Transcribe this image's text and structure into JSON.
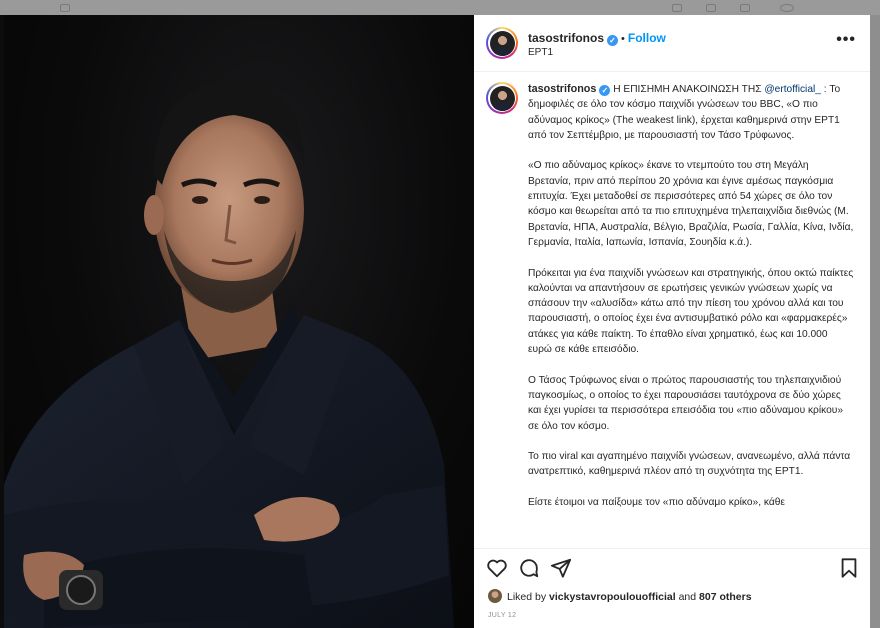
{
  "post": {
    "username": "tasostrifonos",
    "location": "ΕΡΤ1",
    "follow_label": "Follow",
    "separator": "•"
  },
  "caption": {
    "username": "tasostrifonos",
    "intro_before_mention": " Η ΕΠΙΣΗΜΗ ΑΝΑΚΟΙΝΩΣΗ ΤΗΣ ",
    "mention": "@ertofficial_",
    "intro_after_mention": " : Το δημοφιλές σε όλο τον κόσμο παιχνίδι γνώσεων του BBC, «Ο πιο αδύναμος κρίκος» (The weakest link), έρχεται καθημερινά στην ΕΡΤ1 από τον Σεπτέμβριο, με παρουσιαστή τον Τάσο Τρύφωνος.",
    "paragraphs": [
      "«Ο πιο αδύναμος κρίκος» έκανε το ντεμπούτο του στη Μεγάλη Βρετανία, πριν από περίπου 20 χρόνια και έγινε αμέσως παγκόσμια επιτυχία. Έχει μεταδοθεί σε περισσότερες από 54 χώρες σε όλο τον κόσμο και θεωρείται από τα πιο επιτυχημένα τηλεπαιχνίδια διεθνώς (Μ. Βρετανία, ΗΠΑ, Αυστραλία, Βέλγιο, Βραζιλία, Ρωσία, Γαλλία, Κίνα, Ινδία, Γερμανία, Ιταλία, Ιαπωνία, Ισπανία, Σουηδία κ.ά.).",
      "Πρόκειται για ένα παιχνίδι γνώσεων και στρατηγικής, όπου οκτώ παίκτες καλούνται να απαντήσουν σε ερωτήσεις γενικών γνώσεων χωρίς να σπάσουν την «αλυσίδα» κάτω από την πίεση του χρόνου αλλά και του παρουσιαστή, ο οποίος έχει ένα αντισυμβατικό ρόλο και «φαρμακερές» ατάκες για κάθε παίκτη. Το έπαθλο είναι χρηματικό, έως και 10.000 ευρώ σε κάθε επεισόδιο.",
      "Ο Τάσος Τρύφωνος είναι ο πρώτος παρουσιαστής του τηλεπαιχνιδιού παγκοσμίως, ο οποίος το έχει παρουσιάσει ταυτόχρονα σε δύο χώρες και έχει γυρίσει τα περισσότερα επεισόδια του «πιο αδύναμου κρίκου» σε όλο τον κόσμο.",
      "Το πιο viral και αγαπημένο παιχνίδι γνώσεων, ανανεωμένο, αλλά πάντα ανατρεπτικό, καθημερινά πλέον από τη συχνότητα της ΕΡΤ1.",
      "Είστε έτοιμοι να παίξουμε τον «πιο αδύναμο κρίκο», κάθε"
    ]
  },
  "likes": {
    "prefix": "Liked by ",
    "user": "vickystavropoulouofficial",
    "middle": " and ",
    "others": "807 others"
  },
  "date": "JULY 12",
  "icons": {
    "more": "more-options-icon",
    "like": "heart-icon",
    "comment": "comment-icon",
    "share": "share-icon",
    "save": "bookmark-icon"
  },
  "colors": {
    "follow": "#0095f6",
    "verified": "#3897f0",
    "mention": "#00376b",
    "overlay": "#8e8e8e"
  }
}
